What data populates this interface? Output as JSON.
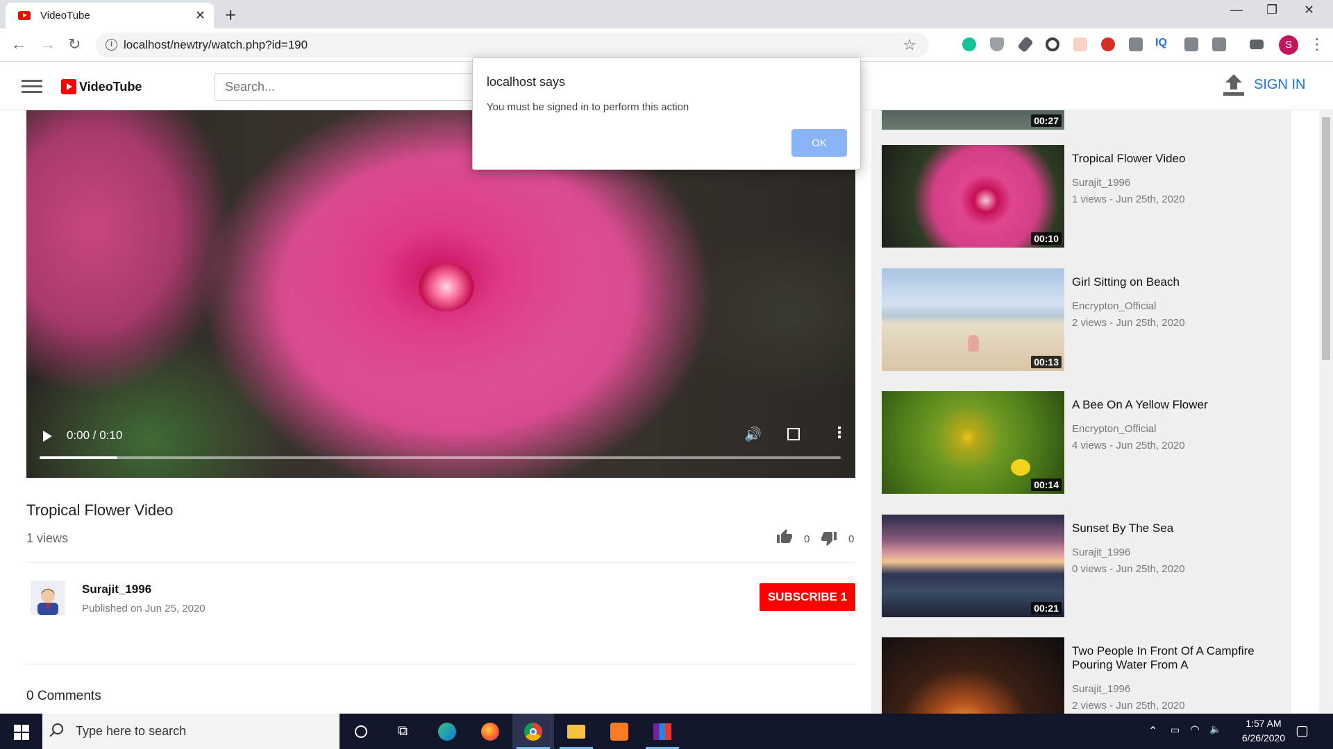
{
  "browser": {
    "tab_title": "VideoTube",
    "url": "localhost/newtry/watch.php?id=190",
    "profile_initial": "S"
  },
  "header": {
    "logo_text": "VideoTube",
    "search_placeholder": "Search...",
    "signin_label": "SIGN IN"
  },
  "video": {
    "time": "0:00 / 0:10",
    "progress": 0.097,
    "title": "Tropical Flower Video",
    "views": "1 views",
    "likes": "0",
    "dislikes": "0",
    "channel": "Surajit_1996",
    "published": "Published on Jun 25, 2020",
    "subscribe_label": "SUBSCRIBE 1",
    "comments": "0 Comments"
  },
  "sidebar": {
    "partial_duration": "00:27",
    "items": [
      {
        "title": "Tropical Flower Video",
        "channel": "Surajit_1996",
        "meta": "1 views - Jun 25th, 2020",
        "duration": "00:10"
      },
      {
        "title": "Girl Sitting on Beach",
        "channel": "Encrypton_Official",
        "meta": "2 views - Jun 25th, 2020",
        "duration": "00:13"
      },
      {
        "title": "A Bee On A Yellow Flower",
        "channel": "Encrypton_Official",
        "meta": "4 views - Jun 25th, 2020",
        "duration": "00:14"
      },
      {
        "title": "Sunset By The Sea",
        "channel": "Surajit_1996",
        "meta": "0 views - Jun 25th, 2020",
        "duration": "00:21"
      },
      {
        "title": "Two People In Front Of A Campfire Pouring Water From A",
        "channel": "Surajit_1996",
        "meta": "2 views - Jun 25th, 2020",
        "duration": ""
      }
    ]
  },
  "dialog": {
    "title": "localhost says",
    "message": "You must be signed in to perform this action",
    "ok_label": "OK"
  },
  "taskbar": {
    "search_placeholder": "Type here to search",
    "time": "1:57 AM",
    "date": "6/26/2020"
  },
  "colors": {
    "brand_red": "#ff0000",
    "link_blue": "#1a73e8",
    "dialog_ok": "#8ab4f8"
  }
}
